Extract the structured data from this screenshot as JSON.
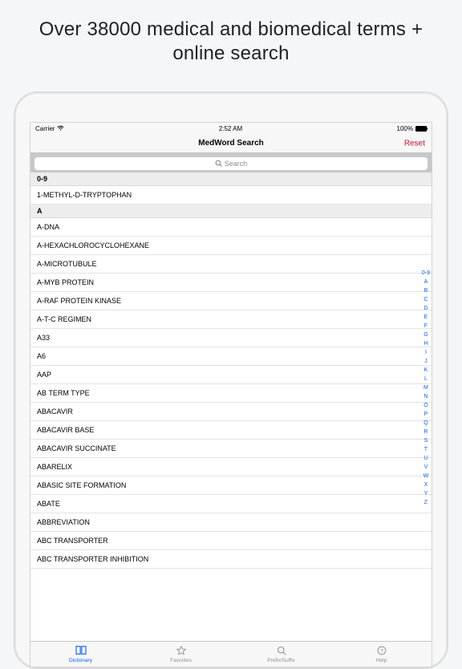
{
  "headline": "Over 38000 medical and biomedical terms + online search",
  "status": {
    "carrier": "Carrier",
    "time": "2:52 AM",
    "battery": "100%"
  },
  "nav": {
    "title": "MedWord Search",
    "reset": "Reset"
  },
  "search": {
    "placeholder": "Search"
  },
  "sections": {
    "num": {
      "header": "0-9",
      "rows": [
        "1-METHYL-D-TRYPTOPHAN"
      ]
    },
    "a": {
      "header": "A",
      "rows": [
        "A-DNA",
        "A-HEXACHLOROCYCLOHEXANE",
        "A-MICROTUBULE",
        "A-MYB PROTEIN",
        "A-RAF PROTEIN KINASE",
        "A-T-C REGIMEN",
        "A33",
        "A6",
        "AAP",
        "AB TERM TYPE",
        "ABACAVIR",
        "ABACAVIR BASE",
        "ABACAVIR SUCCINATE",
        "ABARELIX",
        "ABASIC SITE FORMATION",
        "ABATE",
        "ABBREVIATION",
        "ABC TRANSPORTER",
        "ABC TRANSPORTER INHIBITION"
      ]
    }
  },
  "index": [
    "0-9",
    "A",
    "B",
    "C",
    "D",
    "E",
    "F",
    "G",
    "H",
    "I",
    "J",
    "K",
    "L",
    "M",
    "N",
    "O",
    "P",
    "Q",
    "R",
    "S",
    "T",
    "U",
    "V",
    "W",
    "X",
    "Y",
    "Z"
  ],
  "tabs": [
    "Dictionary",
    "Favorites",
    "Prefix/Suffix",
    "Help"
  ]
}
